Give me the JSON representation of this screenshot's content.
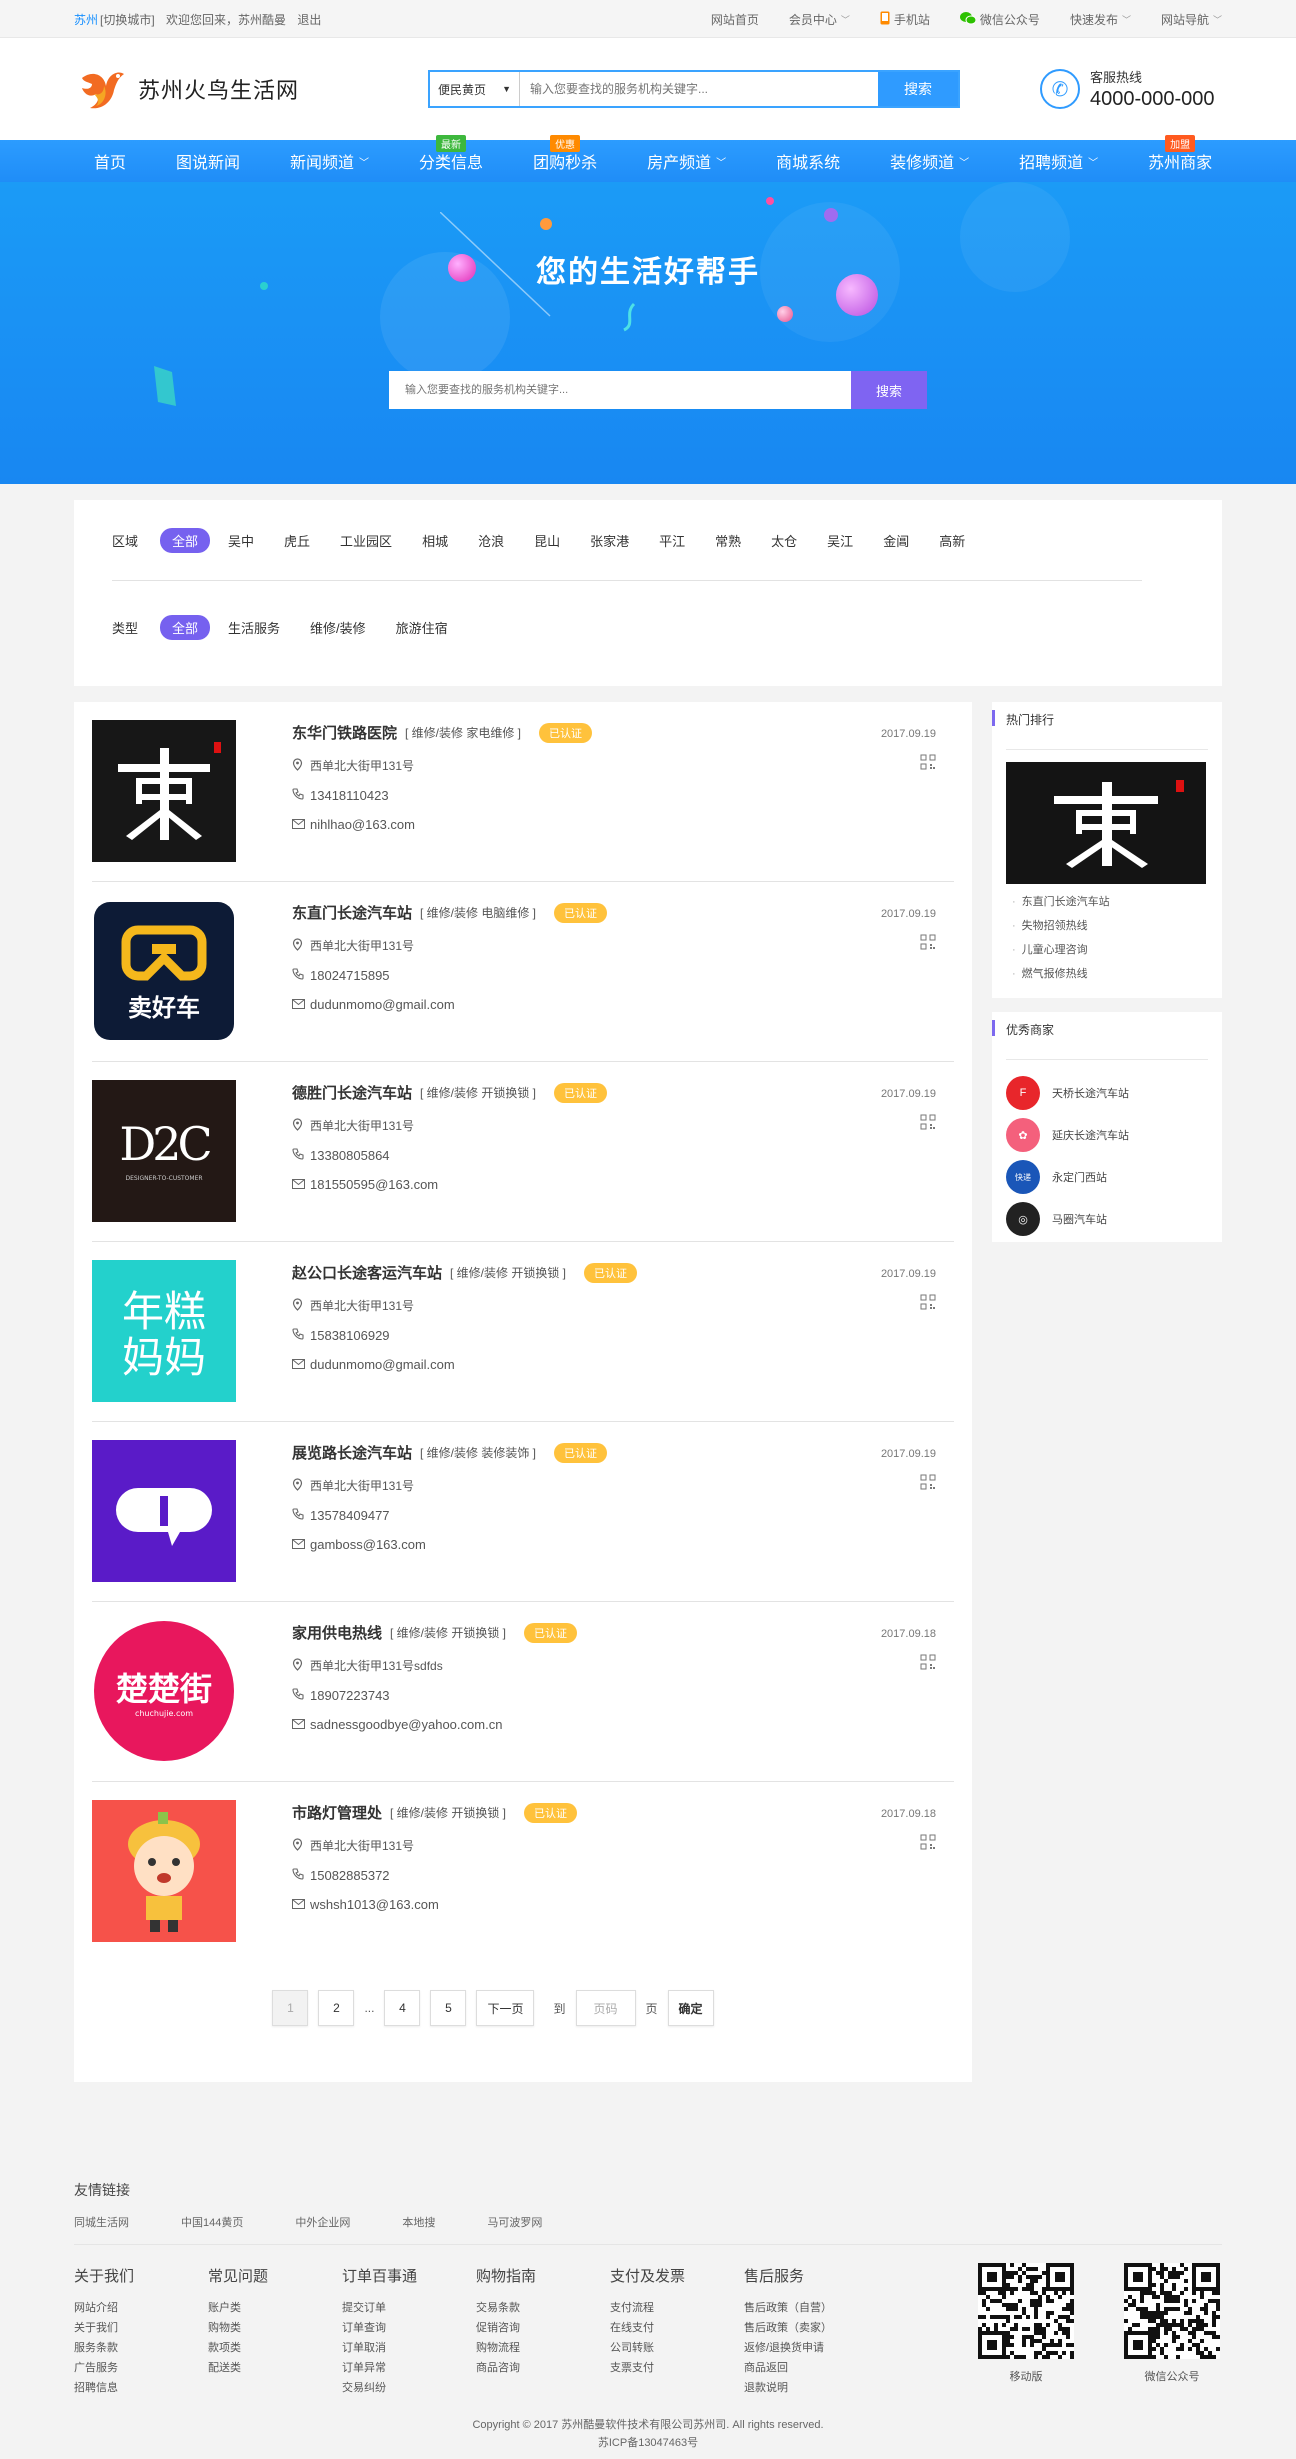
{
  "topbar": {
    "city": "苏州",
    "switch_city": "[切换城市]",
    "welcome": "欢迎您回来，苏州酷曼",
    "logout": "退出",
    "links": [
      {
        "label": "网站首页",
        "icon": "",
        "caret": false
      },
      {
        "label": "会员中心",
        "icon": "",
        "caret": true
      },
      {
        "label": "手机站",
        "icon": "mobile-icon",
        "caret": false
      },
      {
        "label": "微信公众号",
        "icon": "wechat-icon",
        "caret": false
      },
      {
        "label": "快速发布",
        "icon": "",
        "caret": true
      },
      {
        "label": "网站导航",
        "icon": "",
        "caret": true
      }
    ]
  },
  "header": {
    "site_name": "苏州火鸟生活网",
    "search_category": "便民黄页",
    "search_placeholder": "输入您要查找的服务机构关键字...",
    "search_button": "搜索",
    "hotline_label": "客服热线",
    "hotline_number": "4000-000-000"
  },
  "nav": [
    {
      "label": "首页",
      "dropdown": false,
      "badge": "",
      "badge_color": ""
    },
    {
      "label": "图说新闻",
      "dropdown": false,
      "badge": "",
      "badge_color": ""
    },
    {
      "label": "新闻频道",
      "dropdown": true,
      "badge": "",
      "badge_color": ""
    },
    {
      "label": "分类信息",
      "dropdown": false,
      "badge": "最新",
      "badge_color": "#3db83d"
    },
    {
      "label": "团购秒杀",
      "dropdown": false,
      "badge": "优惠",
      "badge_color": "#ff8a00"
    },
    {
      "label": "房产频道",
      "dropdown": true,
      "badge": "",
      "badge_color": ""
    },
    {
      "label": "商城系统",
      "dropdown": false,
      "badge": "",
      "badge_color": ""
    },
    {
      "label": "装修频道",
      "dropdown": true,
      "badge": "",
      "badge_color": ""
    },
    {
      "label": "招聘频道",
      "dropdown": true,
      "badge": "",
      "badge_color": ""
    },
    {
      "label": "苏州商家",
      "dropdown": false,
      "badge": "加盟",
      "badge_color": "#ff5a1f"
    }
  ],
  "banner": {
    "title": "您的生活好帮手",
    "search_placeholder": "输入您要查找的服务机构关键字...",
    "search_button": "搜索"
  },
  "filter": {
    "region_label": "区域",
    "region_options": [
      "全部",
      "吴中",
      "虎丘",
      "工业园区",
      "相城",
      "沧浪",
      "昆山",
      "张家港",
      "平江",
      "常熟",
      "太仓",
      "吴江",
      "金阊",
      "高新"
    ],
    "type_label": "类型",
    "type_options": [
      "全部",
      "生活服务",
      "维修/装修",
      "旅游住宿"
    ]
  },
  "listings": [
    {
      "name": "东华门铁路医院",
      "tags": "[ 维修/装修 家电维修 ]",
      "badge": "已认证",
      "address": "西单北大街甲131号",
      "phone": "13418110423",
      "email": "nihlhao@163.com",
      "date": "2017.09.19",
      "logo": "dong"
    },
    {
      "name": "东直门长途汽车站",
      "tags": "[ 维修/装修 电脑维修 ]",
      "badge": "已认证",
      "address": "西单北大街甲131号",
      "phone": "18024715895",
      "email": "dudunmomo@gmail.com",
      "date": "2017.09.19",
      "logo": "maihaoche"
    },
    {
      "name": "德胜门长途汽车站",
      "tags": "[ 维修/装修 开锁换锁 ]",
      "badge": "已认证",
      "address": "西单北大街甲131号",
      "phone": "13380805864",
      "email": "181550595@163.com",
      "date": "2017.09.19",
      "logo": "d2c"
    },
    {
      "name": "赵公口长途客运汽车站",
      "tags": "[ 维修/装修 开锁换锁 ]",
      "badge": "已认证",
      "address": "西单北大街甲131号",
      "phone": "15838106929",
      "email": "dudunmomo@gmail.com",
      "date": "2017.09.19",
      "logo": "niangao"
    },
    {
      "name": "展览路长途汽车站",
      "tags": "[ 维修/装修 装修装饰 ]",
      "badge": "已认证",
      "address": "西单北大街甲131号",
      "phone": "13578409477",
      "email": "gamboss@163.com",
      "date": "2017.09.19",
      "logo": "purple"
    },
    {
      "name": "家用供电热线",
      "tags": "[ 维修/装修 开锁换锁 ]",
      "badge": "已认证",
      "address": "西单北大街甲131号sdfds",
      "phone": "18907223743",
      "email": "sadnessgoodbye@yahoo.com.cn",
      "date": "2017.09.18",
      "logo": "chuchu"
    },
    {
      "name": "市路灯管理处",
      "tags": "[ 维修/装修 开锁换锁 ]",
      "badge": "已认证",
      "address": "西单北大街甲131号",
      "phone": "15082885372",
      "email": "wshsh1013@163.com",
      "date": "2017.09.18",
      "logo": "kid"
    }
  ],
  "pagination": {
    "pages": [
      "1",
      "2",
      "...",
      "4",
      "5"
    ],
    "current": "1",
    "next": "下一页",
    "goto_label": "到",
    "page_placeholder": "页码",
    "page_unit": "页",
    "confirm": "确定"
  },
  "sidebar": {
    "hot_title": "热门排行",
    "hot_list": [
      "东直门长途汽车站",
      "失物招领热线",
      "儿童心理咨询",
      "燃气报修热线"
    ],
    "merchants_title": "优秀商家",
    "merchants": [
      {
        "name": "天桥长途汽车站",
        "color": "#e8262b",
        "mark": "F"
      },
      {
        "name": "延庆长途汽车站",
        "color": "#f4607c",
        "mark": "✿"
      },
      {
        "name": "永定门西站",
        "color": "#1a56b8",
        "mark": "快递"
      },
      {
        "name": "马圈汽车站",
        "color": "#222222",
        "mark": "◎"
      }
    ]
  },
  "footer": {
    "links_title": "友情链接",
    "links": [
      "同城生活网",
      "中国144黄页",
      "中外企业网",
      "本地搜",
      "马可波罗网"
    ],
    "columns": [
      {
        "title": "关于我们",
        "items": [
          "网站介绍",
          "关于我们",
          "服务条款",
          "广告服务",
          "招聘信息"
        ]
      },
      {
        "title": "常见问题",
        "items": [
          "账户类",
          "购物类",
          "款项类",
          "配送类"
        ]
      },
      {
        "title": "订单百事通",
        "items": [
          "提交订单",
          "订单查询",
          "订单取消",
          "订单异常",
          "交易纠纷"
        ]
      },
      {
        "title": "购物指南",
        "items": [
          "交易条款",
          "促销咨询",
          "购物流程",
          "商品咨询"
        ]
      },
      {
        "title": "支付及发票",
        "items": [
          "支付流程",
          "在线支付",
          "公司转账",
          "支票支付"
        ]
      },
      {
        "title": "售后服务",
        "items": [
          "售后政策（自营）",
          "售后政策（卖家）",
          "返修/退换货申请",
          "商品返回",
          "退款说明"
        ]
      }
    ],
    "qr_mobile": "移动版",
    "qr_wechat": "微信公众号",
    "copyright": "Copyright © 2017 苏州酷曼软件技术有限公司苏州司. All rights reserved.",
    "icp": "苏ICP备13047463号"
  }
}
